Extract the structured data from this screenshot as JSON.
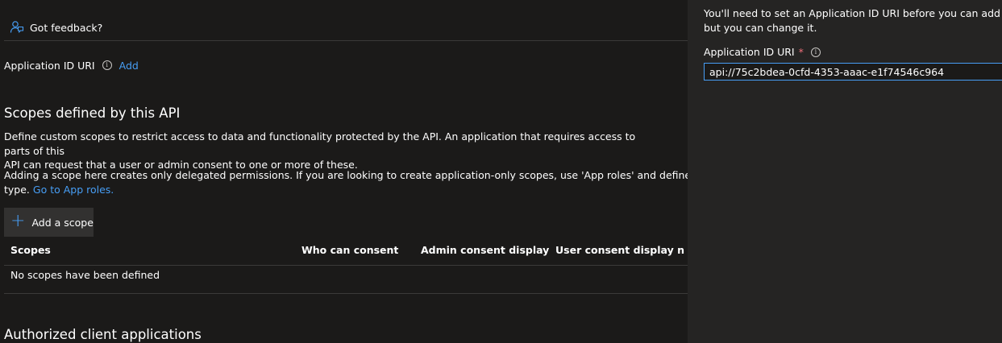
{
  "feedback": {
    "label": "Got feedback?"
  },
  "application_id": {
    "label": "Application ID URI",
    "info": "i",
    "add_link": "Add"
  },
  "scopes": {
    "title": "Scopes defined by this API",
    "description_line1": "Define custom scopes to restrict access to data and functionality protected by the API. An application that requires access to parts of this",
    "description_line2": "API can request that a user or admin consent to one or more of these.",
    "delegated_line1": "Adding a scope here creates only delegated permissions. If you are looking to create application-only scopes, use 'App roles' and define app roles as",
    "delegated_line2_prefix": "type.",
    "app_roles_link": "Go to App roles.",
    "add_button": {
      "icon": "plus-icon",
      "icon_glyph": "+",
      "label": "Add a scope"
    },
    "table": {
      "columns": [
        "Scopes",
        "Who can consent",
        "Admin consent display ...",
        "User consent display na..."
      ],
      "empty_message": "No scopes have been defined"
    }
  },
  "authorized": {
    "title": "Authorized client applications"
  },
  "panel": {
    "description_line1": "You'll need to set an Application ID URI before you can add a per",
    "description_line2": "but you can change it.",
    "field_label": "Application ID URI",
    "required_mark": "*",
    "info": "i",
    "uri_value": "api://75c2bdea-0cfd-4353-aaac-e1f74546c964"
  },
  "colors": {
    "accent": "#479ef5",
    "background": "#1b1a19",
    "panel_background": "#252423",
    "required": "#f1707b"
  }
}
